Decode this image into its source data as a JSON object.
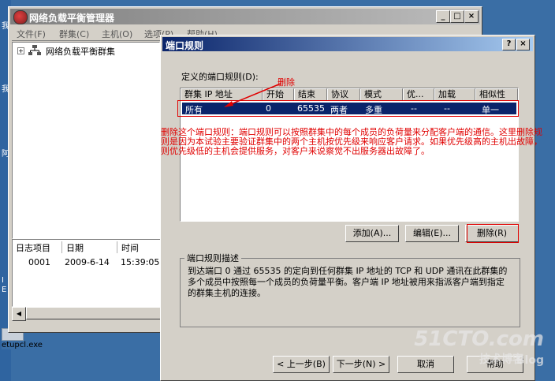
{
  "main_window": {
    "title": "网络负载平衡管理器",
    "caption": {
      "minimize": "_",
      "maximize": "□",
      "close": "×"
    },
    "menu": [
      "文件(F)",
      "群集(C)",
      "主机(O)",
      "选项(P)",
      "帮助(H)"
    ],
    "tree": {
      "expander": "+",
      "root_label": "网络负载平衡群集"
    },
    "log": {
      "columns": [
        "日志项目",
        "日期",
        "时间"
      ],
      "rows": [
        {
          "id": "0001",
          "date": "2009-6-14",
          "time": "15:39:05"
        }
      ]
    }
  },
  "desktop": {
    "file_label": "etupcl.exe",
    "side_labels": [
      "我",
      "我",
      "阿",
      "I",
      "E"
    ]
  },
  "dialog": {
    "title": "端口规则",
    "help_btn": "?",
    "close_btn": "×",
    "rules_label": "定义的端口规则(D):",
    "columns": [
      "群集 IP 地址",
      "开始",
      "结束",
      "协议",
      "模式",
      "优...",
      "加载",
      "相似性"
    ],
    "rows": [
      {
        "ip": "所有",
        "start": "0",
        "end": "65535",
        "protocol": "两者",
        "mode": "多重",
        "priority": "--",
        "load": "--",
        "affinity": "单一"
      }
    ],
    "buttons": {
      "add": "添加(A)...",
      "edit": "编辑(E)...",
      "remove": "删除(R)"
    },
    "description_title": "端口规则描述",
    "description_text": "到达端口 0 通过 65535 的定向到任何群集 IP 地址的 TCP 和 UDP 通讯在此群集的多个成员中按照每一个成员的负荷量平衡。客户端 IP 地址被用来指派客户端到指定的群集主机的连接。",
    "nav": {
      "back": "< 上一步(B)",
      "next": "下一步(N) >",
      "cancel": "取消",
      "help": "帮助"
    }
  },
  "annotations": {
    "arrow_label": "删除",
    "note": "删除这个端口规则：端口规则可以按照群集中的每个成员的负荷量来分配客户端的通信。这里删除规则是因为本试验主要验证群集中的两个主机按优先级来响应客户请求。如果优先级高的主机出故障，则优先级低的主机会提供服务，对客户来说察觉不出服务器出故障了。"
  },
  "watermark": {
    "brand": "51CTO.com",
    "sub": "技术博客",
    "tag": "Blog"
  },
  "colors": {
    "annotation": "#e00000",
    "selection": "#0a246a",
    "dialog_title": "#0a246a"
  }
}
